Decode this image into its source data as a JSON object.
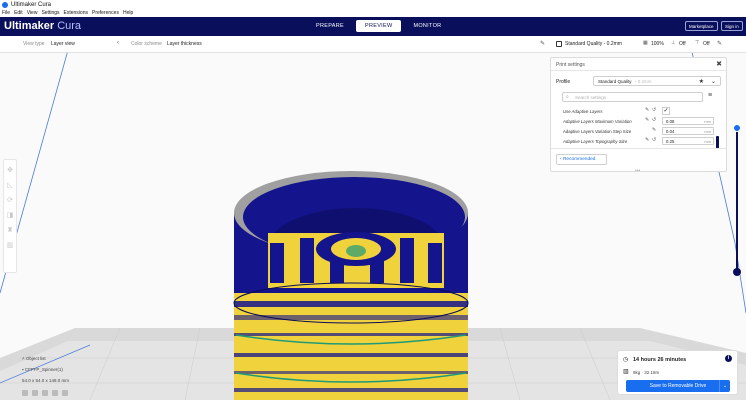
{
  "window": {
    "title": "Ultimaker Cura"
  },
  "menu": [
    "File",
    "Edit",
    "View",
    "Settings",
    "Extensions",
    "Preferences",
    "Help"
  ],
  "header": {
    "logo_bold": "Ultimaker",
    "logo_light": " Cura",
    "stages": [
      "PREPARE",
      "PREVIEW",
      "MONITOR"
    ],
    "active_stage": "PREVIEW",
    "marketplace": "Marketplace",
    "signin": "Sign in"
  },
  "toolbar": {
    "view_type_label": "View type",
    "view_type_value": "Layer view",
    "color_scheme_label": "Color scheme",
    "color_scheme_value": "Layer thickness",
    "quality": "Standard Quality - 0.2mm",
    "infill": "100%",
    "support": "Off",
    "adhesion": "Off"
  },
  "print_settings": {
    "title": "Print settings",
    "profile_label": "Profile",
    "profile_value": "Standard Quality",
    "profile_sub": "- 0.2mm",
    "search_placeholder": "Search settings",
    "settings": [
      {
        "label": "Use Adaptive Layers",
        "type": "checkbox",
        "checked": true
      },
      {
        "label": "Adaptive Layers Maximum Variation",
        "value": "0.08",
        "unit": "mm"
      },
      {
        "label": "Adaptive Layers Variation Step Size",
        "value": "0.04",
        "unit": "mm"
      },
      {
        "label": "Adaptive Layers Topography Size",
        "value": "0.25",
        "unit": "mm"
      }
    ],
    "recommended": "Recommended"
  },
  "objects": {
    "title": "Object list",
    "name": "CFFFP_Spinner(1)",
    "dims": "54.0 x 54.0 x 148.0 mm"
  },
  "job": {
    "time": "14 hours 26 minutes",
    "material": "9kg · 32.18m",
    "save": "Save to Removable Drive"
  },
  "colors": {
    "header": "#0a0f5c",
    "accent": "#196ef0",
    "model_blue": "#14148c",
    "model_yellow": "#f0d23c",
    "model_green": "#1e9a78",
    "grid": "#4a7bd8"
  },
  "layer_slider": {
    "top": 1.0,
    "bottom": 0.0
  }
}
